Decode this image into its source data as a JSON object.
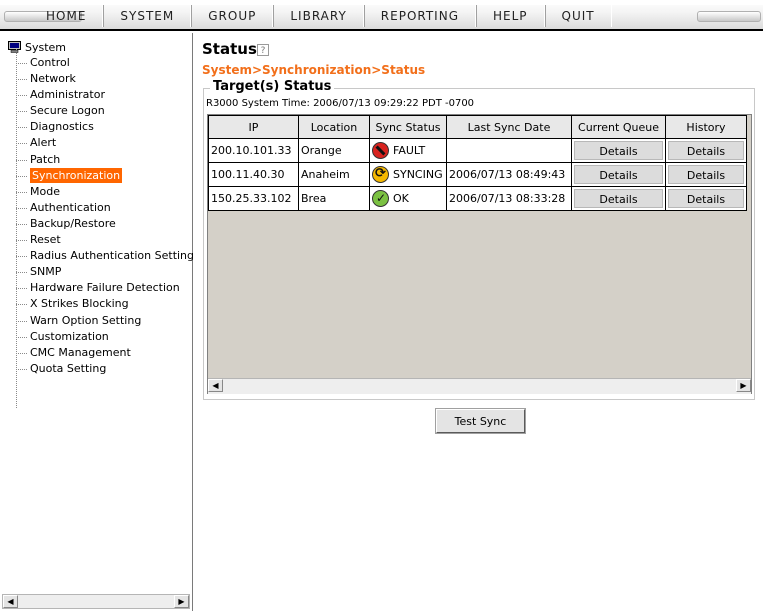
{
  "menu": {
    "items": [
      "HOME",
      "SYSTEM",
      "GROUP",
      "LIBRARY",
      "REPORTING",
      "HELP",
      "QUIT"
    ]
  },
  "tree": {
    "root": "System",
    "items": [
      "Control",
      "Network",
      "Administrator",
      "Secure Logon",
      "Diagnostics",
      "Alert",
      "Patch",
      "Synchronization",
      "Mode",
      "Authentication",
      "Backup/Restore",
      "Reset",
      "Radius Authentication Setting",
      "SNMP",
      "Hardware Failure Detection",
      "X Strikes Blocking",
      "Warn Option Setting",
      "Customization",
      "CMC Management",
      "Quota Setting"
    ],
    "selected": "Synchronization"
  },
  "page": {
    "title": "Status",
    "help_icon": "?",
    "breadcrumb": "System>Synchronization>Status",
    "section_title": "Target(s) Status",
    "system_time": "R3000 System Time: 2006/07/13 09:29:22 PDT -0700"
  },
  "table": {
    "columns": [
      "IP",
      "Location",
      "Sync Status",
      "Last Sync Date",
      "Current Queue",
      "History"
    ],
    "rows": [
      {
        "ip": "200.10.101.33",
        "location": "Orange",
        "status": "FAULT",
        "status_icon": "fault-icon",
        "last_sync": "",
        "queue": "Details",
        "history": "Details"
      },
      {
        "ip": "100.11.40.30",
        "location": "Anaheim",
        "status": "SYNCING",
        "status_icon": "syncing-icon",
        "last_sync": "2006/07/13 08:49:43",
        "queue": "Details",
        "history": "Details"
      },
      {
        "ip": "150.25.33.102",
        "location": "Brea",
        "status": "OK",
        "status_icon": "ok-icon",
        "last_sync": "2006/07/13 08:33:28",
        "queue": "Details",
        "history": "Details"
      }
    ]
  },
  "actions": {
    "test_sync": "Test Sync"
  },
  "colors": {
    "accent": "#ff6600",
    "breadcrumb": "#f26f1a",
    "grid_bg": "#d4d0c8"
  }
}
